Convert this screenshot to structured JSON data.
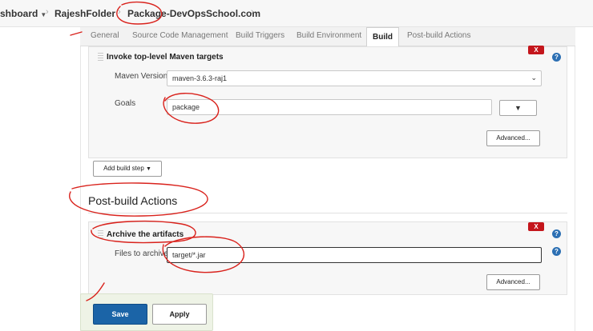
{
  "breadcrumb": {
    "items": [
      "shboard",
      "RajeshFolder",
      "Package-DevOpsSchool.com"
    ],
    "separator": "›"
  },
  "tabs": [
    "General",
    "Source Code Management",
    "Build Triggers",
    "Build Environment",
    "Build",
    "Post-build Actions"
  ],
  "active_tab": "Build",
  "maven_step": {
    "title": "Invoke top-level Maven targets",
    "delete_label": "X",
    "help_label": "?",
    "maven_version_label": "Maven Version",
    "maven_version_value": "maven-3.6.3-raj1",
    "goals_label": "Goals",
    "goals_value": "package",
    "expand_label": "▼",
    "advanced_label": "Advanced..."
  },
  "add_build_step_label": "Add build step",
  "post_build": {
    "heading": "Post-build Actions",
    "archive": {
      "title": "Archive the artifacts",
      "delete_label": "X",
      "help_label": "?",
      "files_label": "Files to archive",
      "files_value": "target/*.jar",
      "advanced_label": "Advanced..."
    }
  },
  "footer": {
    "save_label": "Save",
    "apply_label": "Apply"
  },
  "colors": {
    "annotation": "#d9221c",
    "save_blue": "#1b64a7",
    "delete_red": "#c4161c",
    "help_blue": "#2c6fb3"
  }
}
